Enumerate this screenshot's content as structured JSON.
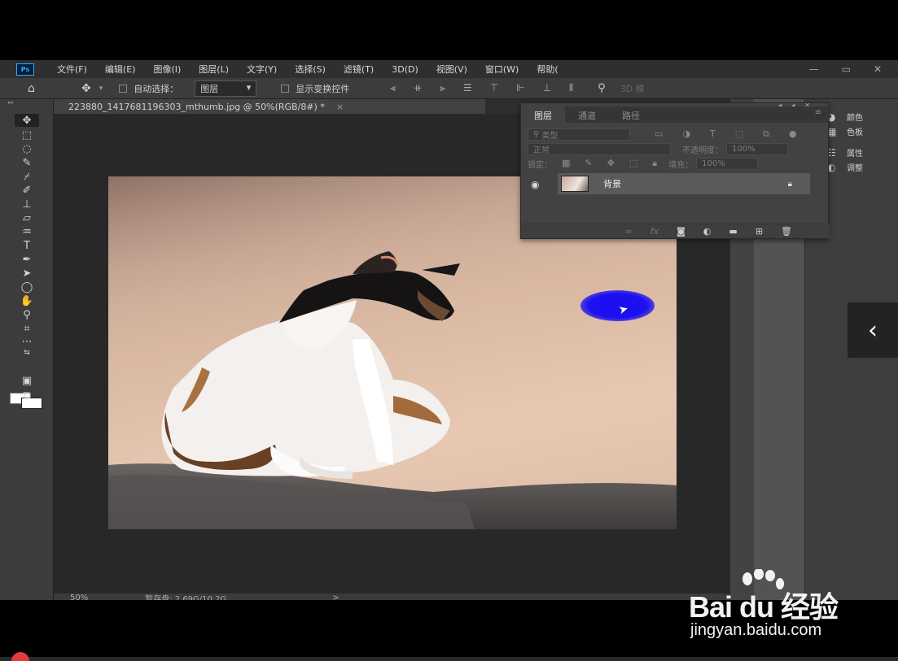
{
  "app": {
    "logo": "Ps",
    "menu": [
      "文件(F)",
      "编辑(E)",
      "图像(I)",
      "图层(L)",
      "文字(Y)",
      "选择(S)",
      "滤镜(T)",
      "3D(D)",
      "视图(V)",
      "窗口(W)",
      "帮助("
    ],
    "window_controls": [
      "—",
      "▭",
      "✕"
    ]
  },
  "options_bar": {
    "auto_select_label": "自动选择：",
    "auto_select_target": "图层",
    "show_transform_label": "显示变换控件",
    "mode_3d": "3D 模"
  },
  "document": {
    "tab_title": "223880_1417681196303_mthumb.jpg @ 50%(RGB/8#) *",
    "close": "×",
    "zoom": "50%",
    "scratch": "暂存盘: 2.69G/10.2G",
    "status_arrow": ">"
  },
  "layers_panel": {
    "tabs": [
      "图层",
      "通道",
      "路径"
    ],
    "filter_kind": "类型",
    "blend_mode": "正常",
    "opacity_label": "不透明度：",
    "opacity_value": "100%",
    "lock_label": "锁定：",
    "fill_label": "填充：",
    "fill_value": "100%",
    "layer_name": "背景",
    "footer_fx": "fx"
  },
  "right_dock": {
    "items": [
      {
        "label": "颜色",
        "icon": "color-wheel-icon"
      },
      {
        "label": "色板",
        "icon": "swatches-grid-icon"
      },
      {
        "label": "属性",
        "icon": "properties-sliders-icon"
      },
      {
        "label": "调整",
        "icon": "adjustments-circle-icon"
      }
    ]
  },
  "watermark": {
    "main": "Bai du 经验",
    "sub": "jingyan.baidu.com"
  },
  "nav_arrow": "‹"
}
